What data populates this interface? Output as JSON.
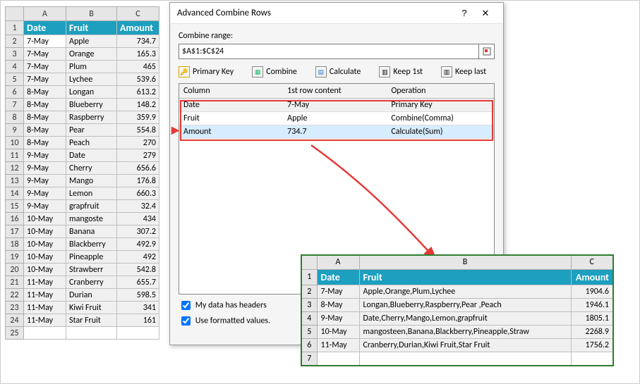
{
  "dialog": {
    "title": "Advanced Combine Rows",
    "help": "?",
    "close": "✕",
    "combine_range_label": "Combine range:",
    "combine_range_value": "$A$1:$C$24",
    "buttons": {
      "primary_key": "Primary Key",
      "combine": "Combine",
      "calculate": "Calculate",
      "keep1st": "Keep 1st",
      "keeplast": "Keep last"
    },
    "grid": {
      "headers": {
        "column": "Column",
        "first": "1st row content",
        "operation": "Operation"
      },
      "rows": [
        {
          "column": "Date",
          "first": "7-May",
          "operation": "Primary Key"
        },
        {
          "column": "Fruit",
          "first": "Apple",
          "operation": "Combine(Comma)"
        },
        {
          "column": "Amount",
          "first": "734.7",
          "operation": "Calculate(Sum)"
        }
      ]
    },
    "checkboxes": {
      "headers": "My data has headers",
      "formatted": "Use formatted values."
    }
  },
  "source": {
    "col_letters": [
      "A",
      "B",
      "C"
    ],
    "headers": {
      "date": "Date",
      "fruit": "Fruit",
      "amount": "Amount"
    },
    "rows": [
      {
        "n": 2,
        "date": "7-May",
        "fruit": "Apple",
        "amount": "734.7"
      },
      {
        "n": 3,
        "date": "7-May",
        "fruit": "Orange",
        "amount": "165.3"
      },
      {
        "n": 4,
        "date": "7-May",
        "fruit": "Plum",
        "amount": "465"
      },
      {
        "n": 5,
        "date": "7-May",
        "fruit": "Lychee",
        "amount": "539.6"
      },
      {
        "n": 6,
        "date": "8-May",
        "fruit": "Longan",
        "amount": "613.2"
      },
      {
        "n": 7,
        "date": "8-May",
        "fruit": "Blueberry",
        "amount": "148.2"
      },
      {
        "n": 8,
        "date": "8-May",
        "fruit": "Raspberry",
        "amount": "359.9"
      },
      {
        "n": 9,
        "date": "8-May",
        "fruit": "Pear",
        "amount": "554.8"
      },
      {
        "n": 10,
        "date": "8-May",
        "fruit": "Peach",
        "amount": "270"
      },
      {
        "n": 11,
        "date": "9-May",
        "fruit": "Date",
        "amount": "279"
      },
      {
        "n": 12,
        "date": "9-May",
        "fruit": "Cherry",
        "amount": "656.6"
      },
      {
        "n": 13,
        "date": "9-May",
        "fruit": "Mango",
        "amount": "176.8"
      },
      {
        "n": 14,
        "date": "9-May",
        "fruit": "Lemon",
        "amount": "660.3"
      },
      {
        "n": 15,
        "date": "9-May",
        "fruit": "grapfruit",
        "amount": "32.4"
      },
      {
        "n": 16,
        "date": "10-May",
        "fruit": "mangoste",
        "amount": "434"
      },
      {
        "n": 17,
        "date": "10-May",
        "fruit": "Banana",
        "amount": "307.2"
      },
      {
        "n": 18,
        "date": "10-May",
        "fruit": "Blackberry",
        "amount": "492.9"
      },
      {
        "n": 19,
        "date": "10-May",
        "fruit": "Pineapple",
        "amount": "492"
      },
      {
        "n": 20,
        "date": "10-May",
        "fruit": "Strawberr",
        "amount": "542.8"
      },
      {
        "n": 21,
        "date": "11-May",
        "fruit": "Cranberry",
        "amount": "655.7"
      },
      {
        "n": 22,
        "date": "11-May",
        "fruit": "Durian",
        "amount": "598.5"
      },
      {
        "n": 23,
        "date": "11-May",
        "fruit": "Kiwi Fruit",
        "amount": "341"
      },
      {
        "n": 24,
        "date": "11-May",
        "fruit": "Star Fruit",
        "amount": "161"
      }
    ],
    "extra_row": "25"
  },
  "result": {
    "col_letters": [
      "A",
      "B",
      "C"
    ],
    "headers": {
      "date": "Date",
      "fruit": "Fruit",
      "amount": "Amount"
    },
    "rows": [
      {
        "n": 2,
        "date": "7-May",
        "fruit": "Apple,Orange,Plum,Lychee",
        "amount": "1904.6"
      },
      {
        "n": 3,
        "date": "8-May",
        "fruit": "Longan,Blueberry,Raspberry,Pear ,Peach",
        "amount": "1946.1"
      },
      {
        "n": 4,
        "date": "9-May",
        "fruit": "Date,Cherry,Mango,Lemon,grapfruit",
        "amount": "1805.1"
      },
      {
        "n": 5,
        "date": "10-May",
        "fruit": "mangosteen,Banana,Blackberry,Pineapple,Straw",
        "amount": "2268.9"
      },
      {
        "n": 6,
        "date": "11-May",
        "fruit": "Cranberry,Durian,Kiwi Fruit,Star Fruit",
        "amount": "1756.2"
      }
    ],
    "extra_row": "7"
  }
}
